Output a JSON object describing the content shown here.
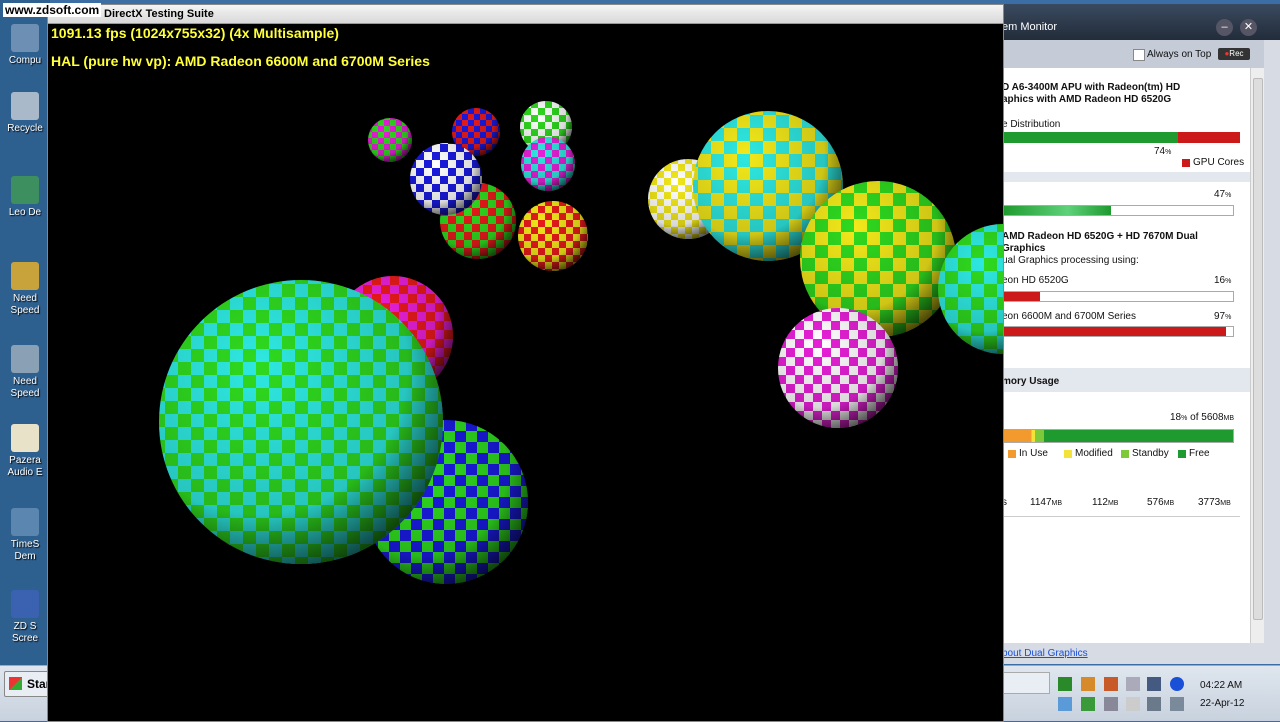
{
  "watermark": "www.zdsoft.com",
  "desktop": {
    "icons": [
      {
        "label": "Compu",
        "icon": "computer-icon"
      },
      {
        "label": "Recycle",
        "icon": "recycle-bin-icon"
      },
      {
        "label": "Leo De",
        "icon": "shortcut-icon"
      },
      {
        "label": "Need",
        "label2": "Speed",
        "icon": "game-shortcut-icon"
      },
      {
        "label": "Need",
        "label2": "Speed",
        "icon": "game-shortcut-icon"
      },
      {
        "label": "Pazera",
        "label2": "Audio E",
        "icon": "audio-extractor-icon"
      },
      {
        "label": "TimeS",
        "label2": "Dem",
        "icon": "shortcut-icon"
      },
      {
        "label": "ZD S",
        "label2": "Scree",
        "icon": "screen-recorder-icon"
      }
    ]
  },
  "dx_window": {
    "title": "DirectX Testing Suite",
    "fps_line": "1091.13 fps (1024x755x32) (4x Multisample)",
    "device_line": "HAL (pure hw vp): AMD Radeon 6600M and 6700M Series",
    "text_color": "#ffff3a"
  },
  "monitor": {
    "title": "em Monitor",
    "always_on_top_label": "Always on Top",
    "rec_label": "Rec",
    "apu_line1": "D A6-3400M APU with Radeon(tm) HD",
    "apu_line2": "aphics with AMD Radeon HD 6520G",
    "distribution_label": "e Distribution",
    "distribution_value": 74,
    "distribution_pct_label": "74",
    "distribution_pct_suffix": "%",
    "gpu_cores_label": "GPU Cores",
    "usage_value": 47,
    "usage_pct_label": "47",
    "dual_title1": "AMD Radeon HD 6520G + HD 7670M Dual",
    "dual_title2": "Graphics",
    "dual_subtitle": "ual Graphics processing using:",
    "gpu1_label": "eon HD 6520G",
    "gpu1_value": 16,
    "gpu1_pct_label": "16",
    "gpu2_label": "eon 6600M and 6700M Series",
    "gpu2_value": 97,
    "gpu2_pct_label": "97",
    "memory_title": "mory Usage",
    "memory_pct_label": "18",
    "memory_of_label": "of 5608",
    "memory_unit": "MB",
    "memory_value": 18,
    "legend": [
      {
        "label": "In Use",
        "color": "#f39a2e"
      },
      {
        "label": "Modified",
        "color": "#f2e23a"
      },
      {
        "label": "Standby",
        "color": "#7dc93a"
      },
      {
        "label": "Free",
        "color": "#1e9a2e"
      }
    ],
    "mem_prefix": "s",
    "mem_values": [
      "1147",
      "112",
      "576",
      "3773"
    ],
    "about_link": "bout Dual Graphics"
  },
  "taskbar": {
    "start_label": "Star",
    "time": "04:22 AM",
    "date": "22-Apr-12"
  },
  "colors": {
    "bar_green": "#1e9a2e",
    "bar_red": "#cc1a1a",
    "bar_light_green": "#5fd17a"
  }
}
